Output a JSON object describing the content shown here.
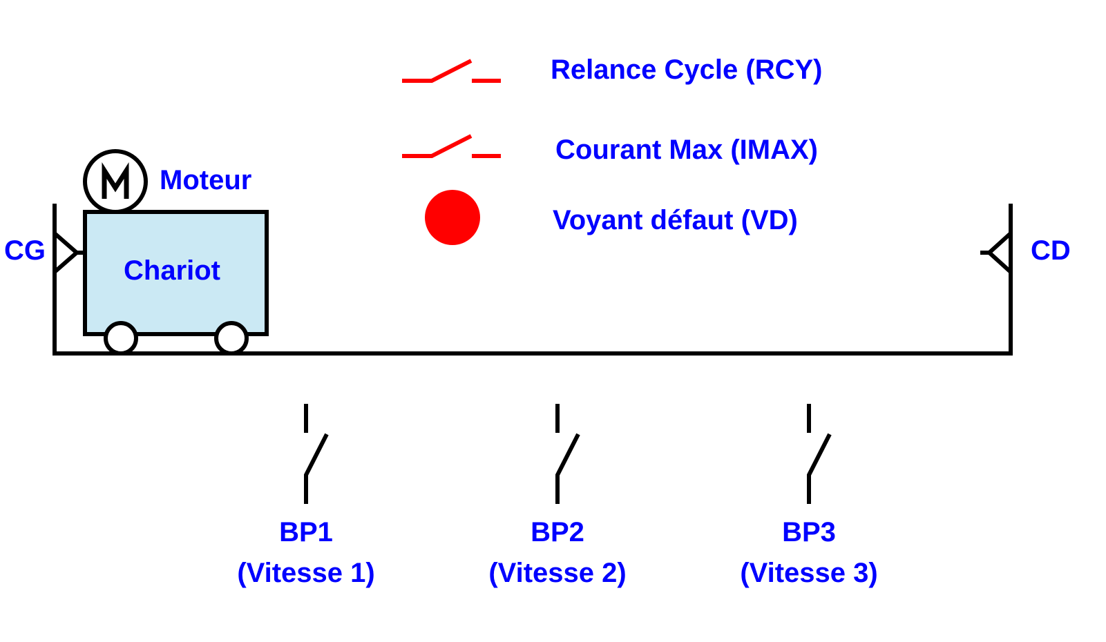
{
  "legend": {
    "rcy": "Relance Cycle (RCY)",
    "imax": "Courant Max (IMAX)",
    "vd": "Voyant défaut (VD)",
    "accent_color": "#ff0000"
  },
  "cart": {
    "motor_label": "Moteur",
    "motor_symbol": "M",
    "cart_label": "Chariot",
    "fill_color": "#cbe9f4"
  },
  "limits": {
    "left": "CG",
    "right": "CD"
  },
  "buttons": [
    {
      "name": "BP1",
      "desc": "(Vitesse 1)"
    },
    {
      "name": "BP2",
      "desc": "(Vitesse 2)"
    },
    {
      "name": "BP3",
      "desc": "(Vitesse 3)"
    }
  ],
  "text_color": "#0000ff"
}
